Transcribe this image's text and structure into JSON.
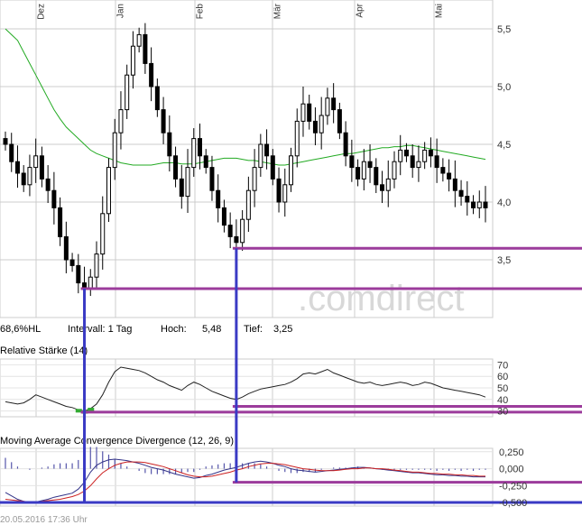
{
  "chart_data": [
    {
      "type": "candlestick",
      "x_labels": [
        "Dez",
        "Jan",
        "Feb",
        "Mär",
        "Apr",
        "Mai"
      ],
      "ylim": [
        3.0,
        5.75
      ],
      "y_ticks": [
        "5,5",
        "5,0",
        "4,5",
        "4,0",
        "3,5"
      ],
      "y_tick_values": [
        5.5,
        5.0,
        4.5,
        4.0,
        3.5
      ],
      "price_series": [
        4.5,
        4.35,
        4.25,
        4.15,
        4.3,
        4.4,
        4.2,
        4.1,
        3.95,
        3.7,
        3.5,
        3.45,
        3.3,
        3.25,
        3.35,
        3.55,
        3.9,
        4.3,
        4.6,
        4.8,
        5.1,
        5.35,
        5.45,
        5.2,
        5.0,
        4.8,
        4.6,
        4.4,
        4.2,
        4.05,
        4.3,
        4.55,
        4.4,
        4.3,
        4.1,
        3.95,
        3.8,
        3.7,
        3.65,
        3.85,
        4.1,
        4.3,
        4.5,
        4.4,
        4.2,
        4.0,
        4.15,
        4.4,
        4.7,
        4.85,
        4.7,
        4.6,
        4.75,
        4.9,
        4.8,
        4.6,
        4.4,
        4.3,
        4.2,
        4.35,
        4.3,
        4.15,
        4.1,
        4.2,
        4.35,
        4.45,
        4.4,
        4.3,
        4.35,
        4.45,
        4.4,
        4.3,
        4.25,
        4.2,
        4.1,
        4.05,
        4.0,
        3.95,
        4.0,
        3.95
      ],
      "ma_series": [
        5.5,
        5.45,
        5.4,
        5.3,
        5.2,
        5.1,
        5.0,
        4.9,
        4.8,
        4.72,
        4.65,
        4.6,
        4.55,
        4.5,
        4.45,
        4.42,
        4.4,
        4.38,
        4.36,
        4.34,
        4.33,
        4.32,
        4.32,
        4.32,
        4.32,
        4.33,
        4.34,
        4.34,
        4.34,
        4.33,
        4.33,
        4.33,
        4.34,
        4.35,
        4.36,
        4.37,
        4.38,
        4.38,
        4.38,
        4.37,
        4.36,
        4.36,
        4.35,
        4.34,
        4.33,
        4.32,
        4.32,
        4.33,
        4.34,
        4.35,
        4.36,
        4.37,
        4.38,
        4.39,
        4.4,
        4.41,
        4.42,
        4.42,
        4.43,
        4.44,
        4.45,
        4.46,
        4.47,
        4.47,
        4.48,
        4.48,
        4.49,
        4.49,
        4.48,
        4.47,
        4.46,
        4.45,
        4.44,
        4.43,
        4.42,
        4.41,
        4.4,
        4.39,
        4.38,
        4.37
      ],
      "hlines": [
        3.6,
        3.25
      ],
      "watermark": ".comdirect"
    },
    {
      "type": "line",
      "title": "Relative Stärke (14)",
      "ylim": [
        25,
        75
      ],
      "y_ticks": [
        "70",
        "60",
        "50",
        "40",
        "30"
      ],
      "y_tick_values": [
        70,
        60,
        50,
        40,
        30
      ],
      "series": [
        38,
        37,
        36,
        37,
        40,
        44,
        42,
        40,
        38,
        36,
        34,
        33,
        31,
        30,
        32,
        36,
        44,
        55,
        64,
        68,
        67,
        66,
        65,
        63,
        60,
        57,
        55,
        52,
        50,
        48,
        52,
        55,
        53,
        50,
        47,
        45,
        43,
        41,
        40,
        42,
        45,
        47,
        49,
        50,
        51,
        52,
        53,
        55,
        58,
        62,
        63,
        62,
        64,
        66,
        63,
        61,
        59,
        57,
        55,
        54,
        55,
        53,
        52,
        53,
        54,
        55,
        54,
        52,
        53,
        55,
        54,
        52,
        50,
        49,
        48,
        47,
        46,
        45,
        44,
        42
      ],
      "hlines": [
        34,
        29
      ]
    },
    {
      "type": "bar+line",
      "title": "Moving Average Convergence Divergence (12, 26, 9)",
      "ylim": [
        -0.55,
        0.3
      ],
      "y_ticks": [
        "0,250",
        "0,000",
        "-0,250",
        "-0,500"
      ],
      "y_tick_values": [
        0.25,
        0.0,
        -0.25,
        -0.5
      ],
      "macd": [
        -0.35,
        -0.4,
        -0.45,
        -0.48,
        -0.5,
        -0.49,
        -0.47,
        -0.45,
        -0.42,
        -0.4,
        -0.38,
        -0.36,
        -0.3,
        -0.2,
        -0.05,
        0.05,
        0.1,
        0.13,
        0.14,
        0.13,
        0.12,
        0.1,
        0.08,
        0.05,
        0.02,
        0.0,
        -0.02,
        -0.05,
        -0.08,
        -0.1,
        -0.12,
        -0.14,
        -0.13,
        -0.1,
        -0.08,
        -0.05,
        -0.02,
        0.0,
        0.02,
        0.05,
        0.08,
        0.1,
        0.11,
        0.1,
        0.08,
        0.05,
        0.03,
        0.0,
        -0.02,
        -0.03,
        -0.04,
        -0.05,
        -0.04,
        -0.03,
        -0.02,
        -0.01,
        0.0,
        0.01,
        0.02,
        0.02,
        0.01,
        0.0,
        -0.01,
        -0.02,
        -0.03,
        -0.04,
        -0.05,
        -0.06,
        -0.06,
        -0.07,
        -0.08,
        -0.09,
        -0.09,
        -0.1,
        -0.1,
        -0.11,
        -0.11,
        -0.12,
        -0.12,
        -0.12
      ],
      "signal": [
        -0.45,
        -0.46,
        -0.47,
        -0.48,
        -0.49,
        -0.49,
        -0.48,
        -0.47,
        -0.46,
        -0.45,
        -0.43,
        -0.41,
        -0.38,
        -0.33,
        -0.25,
        -0.15,
        -0.06,
        0.0,
        0.05,
        0.08,
        0.1,
        0.1,
        0.1,
        0.09,
        0.07,
        0.05,
        0.03,
        0.0,
        -0.03,
        -0.06,
        -0.09,
        -0.11,
        -0.12,
        -0.12,
        -0.11,
        -0.09,
        -0.07,
        -0.05,
        -0.02,
        0.0,
        0.03,
        0.05,
        0.07,
        0.08,
        0.08,
        0.07,
        0.06,
        0.04,
        0.02,
        0.0,
        -0.01,
        -0.02,
        -0.03,
        -0.03,
        -0.03,
        -0.02,
        -0.01,
        0.0,
        0.0,
        0.01,
        0.01,
        0.0,
        0.0,
        -0.01,
        -0.02,
        -0.03,
        -0.04,
        -0.05,
        -0.05,
        -0.06,
        -0.07,
        -0.07,
        -0.08,
        -0.08,
        -0.09,
        -0.09,
        -0.1,
        -0.1,
        -0.11,
        -0.11
      ],
      "hlines": [
        -0.2,
        -0.5
      ]
    }
  ],
  "info": {
    "hl": "68,6%HL",
    "interval": "Intervall: 1 Tag",
    "high_label": "Hoch:",
    "high_value": "5,48",
    "low_label": "Tief:",
    "low_value": "3,25"
  },
  "timestamp": "20.05.2016 17:36 Uhr",
  "colors": {
    "purple": "#9c3c9c",
    "blue": "#3a3ac4",
    "ma_green": "#22aa22",
    "rsi_green": "#33aa33",
    "macd_red": "#cc2222",
    "macd_navy": "#333388",
    "hist": "#5555aa",
    "grid": "#cccccc"
  }
}
